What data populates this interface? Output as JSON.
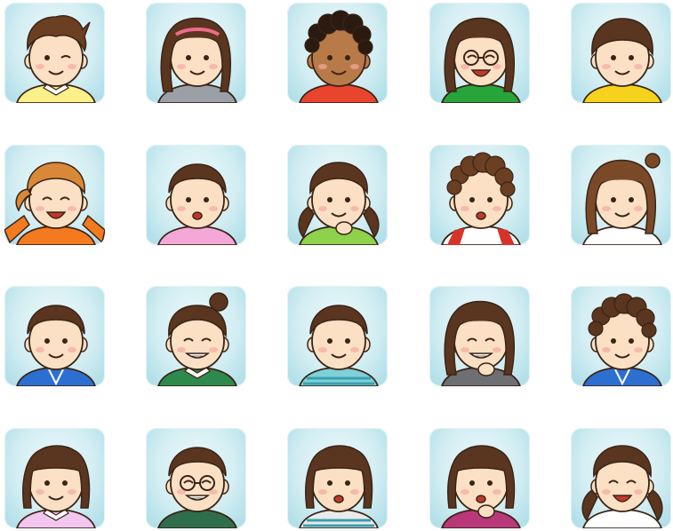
{
  "avatars": [
    {
      "hair": "#6b3f22",
      "skin": "#fbe0c4",
      "shirt": "#fbf089",
      "style": "spiky",
      "expr": "wink",
      "acc": "collar"
    },
    {
      "hair": "#5a3520",
      "skin": "#fbe0c4",
      "shirt": "#9aa0a6",
      "style": "long",
      "expr": "smile",
      "acc": "headband"
    },
    {
      "hair": "#2b1a10",
      "skin": "#b97a4a",
      "shirt": "#e8442e",
      "style": "curly",
      "expr": "smile",
      "acc": "none"
    },
    {
      "hair": "#5a3520",
      "skin": "#fbe0c4",
      "shirt": "#27a43a",
      "style": "long",
      "expr": "laugh",
      "acc": "glasses"
    },
    {
      "hair": "#5a3520",
      "skin": "#fbe0c4",
      "shirt": "#f7d21c",
      "style": "bowl",
      "expr": "smile",
      "acc": "none"
    },
    {
      "hair": "#d9883a",
      "skin": "#fbe0c4",
      "shirt": "#f37a1f",
      "style": "ponytail",
      "expr": "laugh",
      "acc": "arms"
    },
    {
      "hair": "#5a3520",
      "skin": "#fbe0c4",
      "shirt": "#f3a8d8",
      "style": "short",
      "expr": "open",
      "acc": "none"
    },
    {
      "hair": "#5a3520",
      "skin": "#fbe0c4",
      "shirt": "#8ed14a",
      "style": "pigtails",
      "expr": "smile",
      "acc": "hand"
    },
    {
      "hair": "#6b3f22",
      "skin": "#fbe0c4",
      "shirt": "#ffffff",
      "style": "curly",
      "expr": "open",
      "acc": "raglan"
    },
    {
      "hair": "#7a4a28",
      "skin": "#fbe0c4",
      "shirt": "#ffffff",
      "style": "long",
      "expr": "smile",
      "acc": "topknot"
    },
    {
      "hair": "#5a3520",
      "skin": "#fbe0c4",
      "shirt": "#2d6fd1",
      "style": "short",
      "expr": "smile",
      "acc": "hood"
    },
    {
      "hair": "#5a3520",
      "skin": "#fbe0c4",
      "shirt": "#2e8a4c",
      "style": "bun",
      "expr": "grin",
      "acc": "collar"
    },
    {
      "hair": "#5a3520",
      "skin": "#fbe0c4",
      "shirt": "#7fd0d8",
      "style": "short",
      "expr": "smile",
      "acc": "stripes"
    },
    {
      "hair": "#5a3520",
      "skin": "#fbe0c4",
      "shirt": "#6d6f73",
      "style": "long",
      "expr": "grin",
      "acc": "hand"
    },
    {
      "hair": "#5a3520",
      "skin": "#fbe0c4",
      "shirt": "#2d6fd1",
      "style": "curly",
      "expr": "smile",
      "acc": "hood"
    },
    {
      "hair": "#5a3520",
      "skin": "#fbe0c4",
      "shirt": "#f3c6f0",
      "style": "bob",
      "expr": "smile",
      "acc": "collar"
    },
    {
      "hair": "#5a3520",
      "skin": "#fbe0c4",
      "shirt": "#2e6e4c",
      "style": "short",
      "expr": "grin",
      "acc": "glasses"
    },
    {
      "hair": "#5a3520",
      "skin": "#fbe0c4",
      "shirt": "#eaeaea",
      "style": "bob",
      "expr": "open",
      "acc": "stripes"
    },
    {
      "hair": "#5a3520",
      "skin": "#fbe0c4",
      "shirt": "#b8387a",
      "style": "bob",
      "expr": "open",
      "acc": "hand"
    },
    {
      "hair": "#5a3520",
      "skin": "#fbe0c4",
      "shirt": "#ffffff",
      "style": "pigtails",
      "expr": "laugh",
      "acc": "none"
    }
  ]
}
